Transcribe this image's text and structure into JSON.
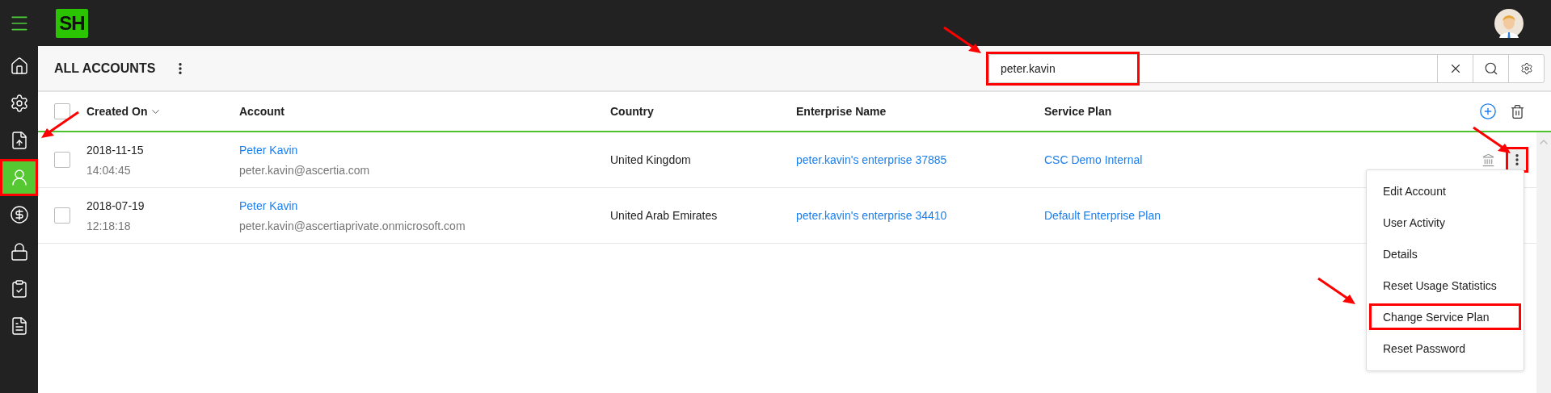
{
  "topbar": {
    "logo": "SH"
  },
  "sidebar": {
    "items": [
      {
        "selected": false,
        "highlighted": false
      },
      {
        "selected": false,
        "highlighted": false
      },
      {
        "selected": false,
        "highlighted": false
      },
      {
        "selected": true,
        "highlighted": true
      },
      {
        "selected": false,
        "highlighted": false
      },
      {
        "selected": false,
        "highlighted": false
      },
      {
        "selected": false,
        "highlighted": false
      },
      {
        "selected": false,
        "highlighted": false
      }
    ]
  },
  "page": {
    "title": "ALL ACCOUNTS"
  },
  "search": {
    "value": "peter.kavin",
    "highlighted": true
  },
  "table": {
    "select_all_checked": false,
    "columns": [
      "Created On",
      "Account",
      "Country",
      "Enterprise Name",
      "Service Plan"
    ],
    "rows": [
      {
        "date": "2018-11-15",
        "time": "14:04:45",
        "name": "Peter Kavin",
        "email": "peter.kavin@ascertia.com",
        "country": "United Kingdom",
        "enterprise": "peter.kavin's enterprise 37885",
        "plan": "CSC Demo Internal",
        "checked": false,
        "menu_open": true,
        "highlighted": true
      },
      {
        "date": "2018-07-19",
        "time": "12:18:18",
        "name": "Peter Kavin",
        "email": "peter.kavin@ascertiaprivate.onmicrosoft.com",
        "country": "United Arab Emirates",
        "enterprise": "peter.kavin's enterprise 34410",
        "plan": "Default Enterprise Plan",
        "checked": false,
        "menu_open": false,
        "highlighted": false
      }
    ]
  },
  "row_menu": {
    "items": [
      {
        "label": "Edit Account",
        "highlighted": false
      },
      {
        "label": "User Activity",
        "highlighted": false
      },
      {
        "label": "Details",
        "highlighted": false
      },
      {
        "label": "Reset Usage Statistics",
        "highlighted": false
      },
      {
        "label": "Change Service Plan",
        "highlighted": true
      },
      {
        "label": "Reset Password",
        "highlighted": false
      }
    ]
  }
}
